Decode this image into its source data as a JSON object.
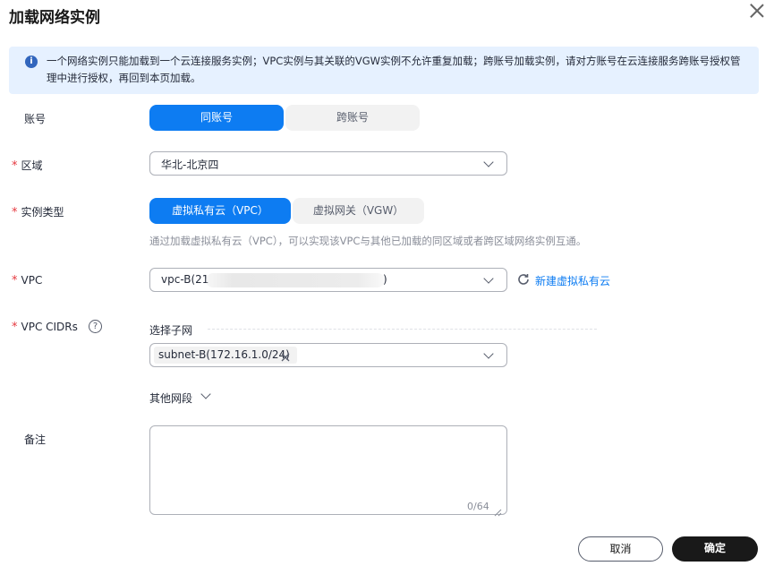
{
  "dialog": {
    "title": "加载网络实例"
  },
  "notice": {
    "text": "一个网络实例只能加载到一个云连接服务实例；VPC实例与其关联的VGW实例不允许重复加载；跨账号加载实例，请对方账号在云连接服务跨账号授权管理中进行授权，再回到本页加载。"
  },
  "account": {
    "label": "账号",
    "options": [
      "同账号",
      "跨账号"
    ],
    "selected": "同账号"
  },
  "region": {
    "label": "区域",
    "value": "华北-北京四"
  },
  "instance_type": {
    "label": "实例类型",
    "options": [
      "虚拟私有云（VPC）",
      "虚拟网关（VGW）"
    ],
    "selected": "虚拟私有云（VPC）",
    "hint": "通过加载虚拟私有云（VPC），可以实现该VPC与其他已加载的同区域或者跨区域网络实例互通。"
  },
  "vpc": {
    "label": "VPC",
    "value_prefix": "vpc-B(21",
    "value_suffix": ")",
    "create_link": "新建虚拟私有云"
  },
  "vpc_cidrs": {
    "label": "VPC CIDRs",
    "subnet_title": "选择子网",
    "selected_tag": "subnet-B(172.16.1.0/24)",
    "other_segments": "其他网段"
  },
  "remark": {
    "label": "备注",
    "counter": "0/64"
  },
  "footer": {
    "cancel": "取消",
    "confirm": "确定"
  },
  "colors": {
    "primary": "#0d7cf2",
    "notice_bg": "#e6f1ff",
    "required": "#e5383e",
    "confirm_bg": "#191919"
  }
}
